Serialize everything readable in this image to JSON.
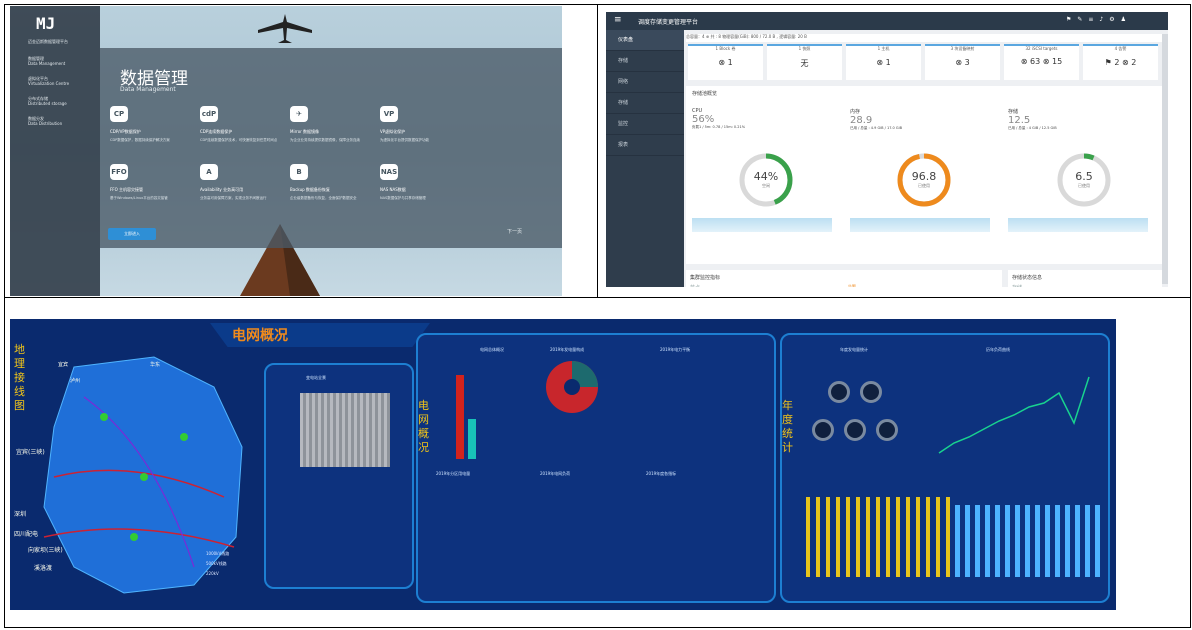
{
  "panel1": {
    "logo_text": "MJ",
    "logo_subtitle": "迈金迈斯数据管理平台",
    "nav": [
      {
        "cn": "数据管理",
        "en": "Data Management"
      },
      {
        "cn": "虚拟化平台",
        "en": "Virtualization Centre"
      },
      {
        "cn": "分布式存储",
        "en": "Distributed storage"
      },
      {
        "cn": "数据分发",
        "en": "Data Distribution"
      }
    ],
    "title": "数据管理",
    "subtitle": "Data Management",
    "features": [
      {
        "icon": "CP",
        "name": "CDP/VP数据保护",
        "desc": "CDP数据保护，数据持续保护解决方案"
      },
      {
        "icon": "cdP",
        "name": "CDP连续数据保护",
        "desc": "CDP连续数据保护技术，可快速恢复到任意时间点"
      },
      {
        "icon": "✈",
        "name": "Mirror 数据镜像",
        "desc": "为企业业务持续提供数据镜像，保障业务连续"
      },
      {
        "icon": "VP",
        "name": "VP虚拟化保护",
        "desc": "为虚拟化平台提供数据保护功能"
      },
      {
        "icon": "FFO",
        "name": "FFO 主机容灾接管",
        "desc": "基于Windows/Linux平台的容灾接管"
      },
      {
        "icon": "A",
        "name": "Availability 业务高可用",
        "desc": "业务高可用保障方案，实现业务不间断运行"
      },
      {
        "icon": "B",
        "name": "Backup 数据备份恢复",
        "desc": "企业级数据备份与恢复，全面保护数据安全"
      },
      {
        "icon": "NAS",
        "name": "NAS NAS数据",
        "desc": "NAS数据保护与共享存储管理"
      }
    ],
    "start_label": "立即进入",
    "next_label": "下一页"
  },
  "panel2": {
    "app_title": "调度存储变更管理平台",
    "nav": [
      "仪表盘",
      "存储",
      "网络",
      "存储",
      "监控",
      "报表"
    ],
    "status_line": "总容量：4 ⊕ 共 : 8 物理容量(GiB): 800 / 72.0 B , 逻辑容量: 20 B",
    "cards": [
      {
        "label": "1 Block 卷",
        "value": "⊗ 1"
      },
      {
        "label": "1 快照",
        "value": "无"
      },
      {
        "label": "1 主机",
        "value": "⊗ 1"
      },
      {
        "label": "3 块设备映射",
        "value": "⊗ 3"
      },
      {
        "label": "32 iSCSI targets",
        "value": "⊗ 63  ⊗ 15"
      },
      {
        "label": "4 告警",
        "value": "⚑ 2  ⊗ 2"
      }
    ],
    "section_title": "存储池概览",
    "metrics": [
      {
        "name": "CPU",
        "pct": "56%",
        "note": "负载1 / 5m: 0.78  /  15m: 0.21%",
        "gauge": "44%",
        "gauge_sub": "空闲",
        "gauge_value": 44,
        "color": "#3aa14b"
      },
      {
        "name": "内存",
        "pct": "28.9",
        "note": "已用 / 总量 : 4.9 GiB / 17.0 GiB",
        "gauge": "96.8",
        "gauge_sub": "已使用",
        "gauge_value": 96.8,
        "color": "#ee8a1d"
      },
      {
        "name": "存储",
        "pct": "12.5",
        "note": "已用 / 总量 : 4 GiB / 12.5 GiB",
        "gauge": "6.5",
        "gauge_sub": "已使用",
        "gauge_value": 6.5,
        "color": "#3aa14b"
      }
    ],
    "bottom": [
      {
        "title": "集群监控指标",
        "label": "节点"
      },
      {
        "title": "",
        "label": "告警"
      },
      {
        "title": "存储状态信息",
        "label": "存储"
      }
    ]
  },
  "panel3": {
    "header": "电网概况",
    "left_vertical": "地理接线图",
    "map_labels": [
      "宜宾",
      "泸州",
      "宜宾(三峡)",
      "深圳",
      "四川配电",
      "向家坝(三峡)",
      "溪洛渡",
      "华东"
    ],
    "map_legend": [
      "1000kV线路",
      "500kV线路",
      "220kV"
    ],
    "overview_vertical": "电网概况",
    "yearly_vertical": "年度统计",
    "panel_titles": [
      "电网总体概况",
      "2019年发电量构成",
      "2019年电力平衡",
      "2019年分区用电量",
      "2019年电网负荷",
      "2019年度各指标",
      "年度发电量统计",
      "历年负荷曲线"
    ],
    "photo_label": "变电站全景"
  }
}
